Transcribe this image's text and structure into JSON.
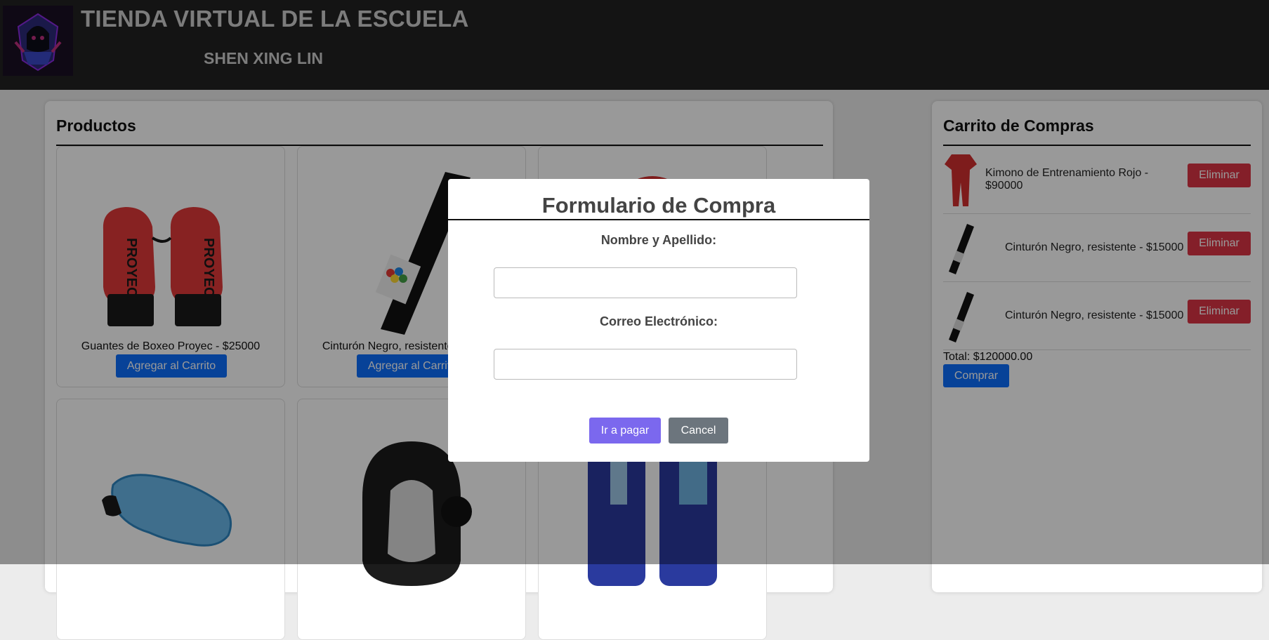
{
  "header": {
    "title": "TIENDA VIRTUAL DE LA ESCUELA",
    "subtitle": "SHEN XING LIN",
    "logo_icon": "hooded-figure-logo"
  },
  "products": {
    "heading": "Productos",
    "add_button_label": "Agregar al Carrito",
    "items": [
      {
        "caption": "Guantes de Boxeo Proyec - $25000",
        "icon": "boxing-gloves-image",
        "brand_text": "PROYEC"
      },
      {
        "caption": "Cinturón Negro, resistente - $15000",
        "icon": "black-belt-image"
      },
      {
        "caption": "",
        "icon": "red-kimono-image"
      },
      {
        "caption": "",
        "icon": "mouthguard-image"
      },
      {
        "caption": "",
        "icon": "headgear-image"
      },
      {
        "caption": "",
        "icon": "shin-guards-image"
      }
    ]
  },
  "cart": {
    "heading": "Carrito de Compras",
    "delete_label": "Eliminar",
    "items": [
      {
        "text": "Kimono de Entrenamiento Rojo - $90000",
        "icon": "red-kimono-thumb"
      },
      {
        "text": "Cinturón Negro, resistente - $15000",
        "icon": "black-belt-thumb"
      },
      {
        "text": "Cinturón Negro, resistente - $15000",
        "icon": "black-belt-thumb"
      }
    ],
    "total": "Total: $120000.00",
    "buy_label": "Comprar"
  },
  "modal": {
    "title": "Formulario de Compra",
    "name_label": "Nombre y Apellido:",
    "name_value": "",
    "email_label": "Correo Electrónico:",
    "email_value": "",
    "pay_label": "Ir a pagar",
    "cancel_label": "Cancel"
  },
  "colors": {
    "header_bg": "#222222",
    "primary": "#0d6efd",
    "danger": "#dc3545",
    "pay": "#7b68ee",
    "secondary": "#6c757d"
  }
}
